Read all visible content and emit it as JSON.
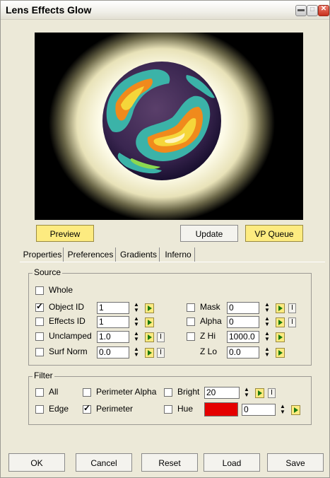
{
  "window": {
    "title": "Lens Effects Glow"
  },
  "preview_buttons": {
    "preview": "Preview",
    "update": "Update",
    "vp_queue": "VP Queue"
  },
  "tabs": [
    "Properties",
    "Preferences",
    "Gradients",
    "Inferno"
  ],
  "source": {
    "label": "Source",
    "whole": {
      "label": "Whole",
      "checked": false
    },
    "object_id": {
      "label": "Object ID",
      "checked": true,
      "value": "1"
    },
    "effects_id": {
      "label": "Effects ID",
      "checked": false,
      "value": "1"
    },
    "unclamped": {
      "label": "Unclamped",
      "checked": false,
      "value": "1.0"
    },
    "surf_norm": {
      "label": "Surf Norm",
      "checked": false,
      "value": "0.0"
    },
    "mask": {
      "label": "Mask",
      "checked": false,
      "value": "0"
    },
    "alpha": {
      "label": "Alpha",
      "checked": false,
      "value": "0"
    },
    "z_hi": {
      "label": "Z Hi",
      "checked": false,
      "value": "1000.0"
    },
    "z_lo": {
      "label": "Z Lo",
      "value": "0.0"
    },
    "invert_glyph": "I"
  },
  "filter": {
    "label": "Filter",
    "all": {
      "label": "All",
      "checked": false
    },
    "edge": {
      "label": "Edge",
      "checked": false
    },
    "perimeter_alpha": {
      "label": "Perimeter Alpha",
      "checked": false
    },
    "perimeter": {
      "label": "Perimeter",
      "checked": true
    },
    "bright": {
      "label": "Bright",
      "checked": false,
      "value": "20"
    },
    "hue": {
      "label": "Hue",
      "checked": false,
      "value": "0",
      "color": "#e50000"
    }
  },
  "bottom_buttons": {
    "ok": "OK",
    "cancel": "Cancel",
    "reset": "Reset",
    "load": "Load",
    "save": "Save"
  },
  "icons": {
    "spinner": "spinner-icon",
    "play": "play-icon",
    "minimize": "minimize-icon",
    "maximize": "maximize-icon",
    "close": "close-icon"
  }
}
